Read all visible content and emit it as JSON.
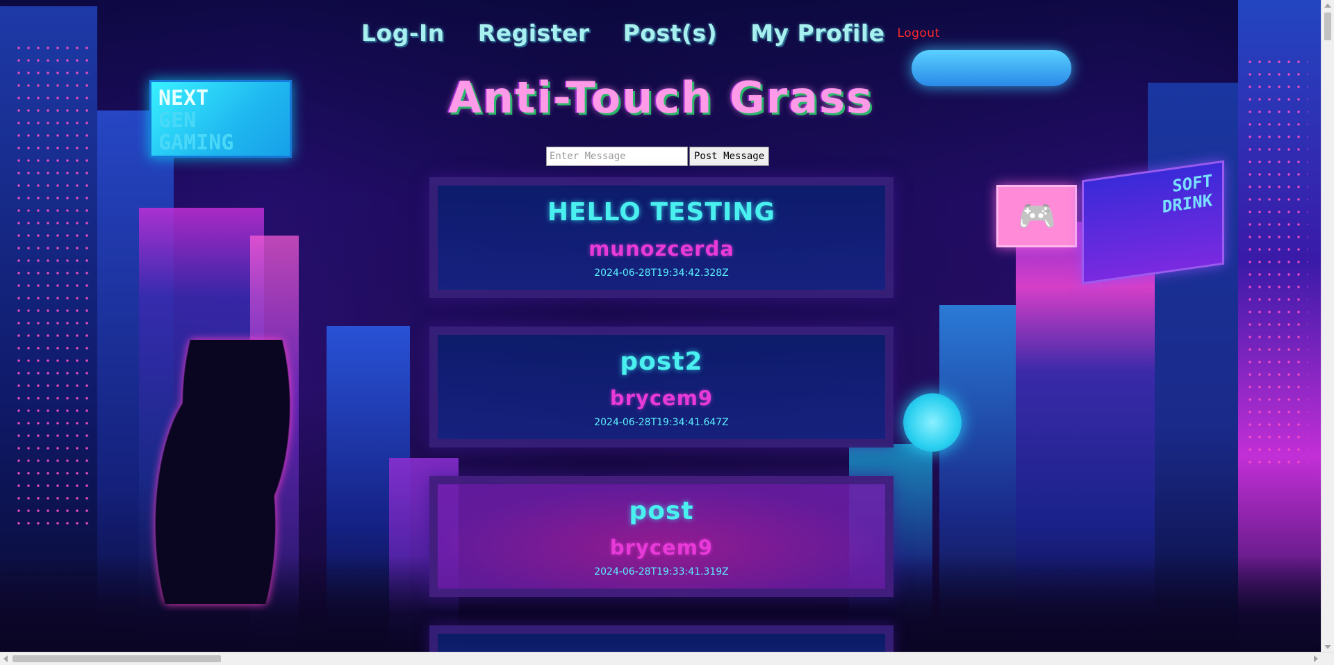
{
  "nav": {
    "login": "Log-In",
    "register": "Register",
    "posts": "Post(s)",
    "profile": "My Profile",
    "logout": "Logout"
  },
  "site": {
    "title": "Anti-Touch Grass"
  },
  "composer": {
    "placeholder": "Enter Message",
    "value": "",
    "button": "Post Message"
  },
  "background_signs": {
    "next_gen": [
      "NEXT",
      "GEN",
      "GAMING"
    ],
    "soft_drink": [
      "SOFT",
      "DRINK"
    ]
  },
  "posts": [
    {
      "title": "HELLO TESTING",
      "author": "munozcerda",
      "timestamp": "2024-06-28T19:34:42.328Z"
    },
    {
      "title": "post2",
      "author": "brycem9",
      "timestamp": "2024-06-28T19:34:41.647Z"
    },
    {
      "title": "post",
      "author": "brycem9",
      "timestamp": "2024-06-28T19:33:41.319Z"
    }
  ],
  "colors": {
    "nav_text": "#a8f0f0",
    "logout": "#ff2a2a",
    "title": "#ff9ae8",
    "post_title": "#4af0f0",
    "post_author": "#e83ad8",
    "post_timestamp": "#5af0ff"
  }
}
